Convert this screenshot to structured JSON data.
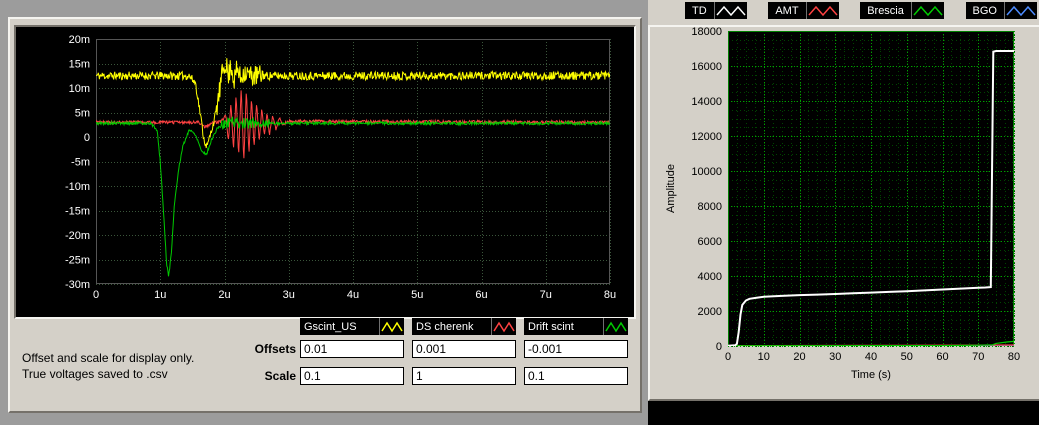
{
  "left_panel": {
    "offsets_label": "Offsets",
    "scale_label": "Scale",
    "offsets": [
      "0.01",
      "0.001",
      "-0.001"
    ],
    "scale": [
      "0.1",
      "1",
      "0.1"
    ],
    "note_line1": "Offset and scale for display only.",
    "note_line2": "True voltages saved to .csv",
    "legend": [
      {
        "label": "Gscint_US",
        "color": "#ffff00"
      },
      {
        "label": "DS cherenk",
        "color": "#ff4242"
      },
      {
        "label": "Drift scint",
        "color": "#00cc00"
      }
    ]
  },
  "right_panel": {
    "legend": [
      {
        "label": "TD",
        "color": "#ffffff"
      },
      {
        "label": "AMT",
        "color": "#ff4242"
      },
      {
        "label": "Brescia",
        "color": "#00cc00"
      },
      {
        "label": "BGO",
        "color": "#4d8cff"
      }
    ]
  },
  "chart_data": [
    {
      "type": "line",
      "title": "",
      "xlabel": "",
      "ylabel": "",
      "xlim": [
        0,
        8
      ],
      "ylim": [
        -30,
        20
      ],
      "x_tick_values": [
        0,
        1,
        2,
        3,
        4,
        5,
        6,
        7,
        8
      ],
      "x_tick_labels": [
        "0",
        "1u",
        "2u",
        "3u",
        "4u",
        "5u",
        "6u",
        "7u",
        "8u"
      ],
      "y_tick_values": [
        20,
        15,
        10,
        5,
        0,
        -5,
        -10,
        -15,
        -20,
        -25,
        -30
      ],
      "y_tick_labels": [
        "20m",
        "15m",
        "10m",
        "5m",
        "0",
        "-5m",
        "-10m",
        "-15m",
        "-20m",
        "-25m",
        "-30m"
      ],
      "grid": true,
      "legend_position": "bottom",
      "series": [
        {
          "name": "DS cherenk",
          "color": "#ff4242",
          "width": 1,
          "noise": 0.3,
          "seed": 9,
          "keypoints": [
            [
              0,
              3
            ],
            [
              1.6,
              3
            ],
            [
              1.7,
              2
            ],
            [
              1.8,
              2.8
            ],
            [
              1.95,
              3.2
            ],
            [
              2.02,
              4.5
            ],
            [
              2.06,
              -1
            ],
            [
              2.1,
              7
            ],
            [
              2.14,
              -3
            ],
            [
              2.18,
              9
            ],
            [
              2.22,
              -4
            ],
            [
              2.26,
              10
            ],
            [
              2.3,
              -5
            ],
            [
              2.34,
              9.5
            ],
            [
              2.38,
              -3.5
            ],
            [
              2.42,
              8
            ],
            [
              2.46,
              -2
            ],
            [
              2.5,
              7
            ],
            [
              2.54,
              -1
            ],
            [
              2.58,
              6
            ],
            [
              2.62,
              0
            ],
            [
              2.66,
              5
            ],
            [
              2.7,
              0.5
            ],
            [
              2.75,
              4.5
            ],
            [
              2.8,
              1.5
            ],
            [
              2.85,
              4
            ],
            [
              2.9,
              2.5
            ],
            [
              3.0,
              3.2
            ],
            [
              8,
              3
            ]
          ]
        },
        {
          "name": "Drift scint",
          "color": "#00cc00",
          "width": 1,
          "noise": 0.3,
          "seed": 5,
          "noise_regions": [
            [
              1.95,
              2.7,
              0.8
            ]
          ],
          "keypoints": [
            [
              0,
              2.8
            ],
            [
              0.85,
              2.8
            ],
            [
              0.95,
              1.5
            ],
            [
              1.0,
              -5
            ],
            [
              1.05,
              -15
            ],
            [
              1.1,
              -26
            ],
            [
              1.13,
              -28.5
            ],
            [
              1.17,
              -24
            ],
            [
              1.22,
              -14
            ],
            [
              1.28,
              -7
            ],
            [
              1.35,
              -2
            ],
            [
              1.45,
              1.5
            ],
            [
              1.55,
              0.5
            ],
            [
              1.65,
              -3
            ],
            [
              1.72,
              -3.5
            ],
            [
              1.8,
              -0.5
            ],
            [
              1.9,
              2
            ],
            [
              2.0,
              2.5
            ],
            [
              2.1,
              3.5
            ],
            [
              2.2,
              2.8
            ],
            [
              8,
              2.8
            ]
          ]
        },
        {
          "name": "Gscint_US",
          "color": "#ffff00",
          "width": 1,
          "noise": 0.85,
          "seed": 11,
          "noise_regions": [
            [
              1.88,
              2.6,
              1.4
            ]
          ],
          "keypoints": [
            [
              0,
              12.5
            ],
            [
              1.45,
              12.5
            ],
            [
              1.55,
              11
            ],
            [
              1.62,
              5
            ],
            [
              1.68,
              -0.5
            ],
            [
              1.73,
              -2
            ],
            [
              1.78,
              0.5
            ],
            [
              1.85,
              4
            ],
            [
              1.92,
              9
            ],
            [
              1.98,
              14
            ],
            [
              2.02,
              15.5
            ],
            [
              2.06,
              12
            ],
            [
              2.1,
              15
            ],
            [
              2.15,
              11.5
            ],
            [
              2.2,
              14
            ],
            [
              2.25,
              12
            ],
            [
              2.3,
              13.5
            ],
            [
              2.4,
              12.5
            ],
            [
              8,
              12.5
            ]
          ]
        }
      ]
    },
    {
      "type": "line",
      "title": "",
      "xlabel": "Time (s)",
      "ylabel": "Amplitude",
      "xlim": [
        0,
        80
      ],
      "ylim": [
        0,
        18000
      ],
      "x_tick_values": [
        0,
        10,
        20,
        30,
        40,
        50,
        60,
        70,
        80
      ],
      "x_tick_labels": [
        "0",
        "10",
        "20",
        "30",
        "40",
        "50",
        "60",
        "70",
        "80"
      ],
      "y_tick_values": [
        0,
        2000,
        4000,
        6000,
        8000,
        10000,
        12000,
        14000,
        16000,
        18000
      ],
      "y_tick_labels": [
        "0",
        "2000",
        "4000",
        "6000",
        "8000",
        "10000",
        "12000",
        "14000",
        "16000",
        "18000"
      ],
      "grid": true,
      "legend_position": "top",
      "series": [
        {
          "name": "BGO",
          "color": "#4d8cff",
          "width": 1.2,
          "keypoints": [
            [
              0,
              10
            ],
            [
              80,
              15
            ]
          ]
        },
        {
          "name": "AMT",
          "color": "#ff4242",
          "width": 1.2,
          "keypoints": [
            [
              0,
              25
            ],
            [
              40,
              35
            ],
            [
              80,
              55
            ]
          ]
        },
        {
          "name": "Brescia",
          "color": "#00cc00",
          "width": 1.2,
          "keypoints": [
            [
              0,
              15
            ],
            [
              60,
              25
            ],
            [
              70,
              45
            ],
            [
              74,
              70
            ],
            [
              75,
              150
            ],
            [
              78,
              230
            ],
            [
              80,
              260
            ]
          ]
        },
        {
          "name": "TD",
          "color": "#ffffff",
          "width": 2,
          "keypoints": [
            [
              0,
              20
            ],
            [
              2,
              40
            ],
            [
              2.5,
              120
            ],
            [
              3,
              800
            ],
            [
              3.5,
              1800
            ],
            [
              4,
              2350
            ],
            [
              5,
              2600
            ],
            [
              6,
              2700
            ],
            [
              8,
              2760
            ],
            [
              10,
              2810
            ],
            [
              15,
              2860
            ],
            [
              20,
              2910
            ],
            [
              25,
              2940
            ],
            [
              30,
              2970
            ],
            [
              35,
              3010
            ],
            [
              40,
              3050
            ],
            [
              45,
              3090
            ],
            [
              50,
              3130
            ],
            [
              55,
              3180
            ],
            [
              60,
              3230
            ],
            [
              65,
              3280
            ],
            [
              70,
              3330
            ],
            [
              72,
              3345
            ],
            [
              73.5,
              3365
            ],
            [
              74.2,
              16820
            ],
            [
              75,
              16860
            ],
            [
              80,
              16860
            ]
          ]
        }
      ]
    }
  ]
}
